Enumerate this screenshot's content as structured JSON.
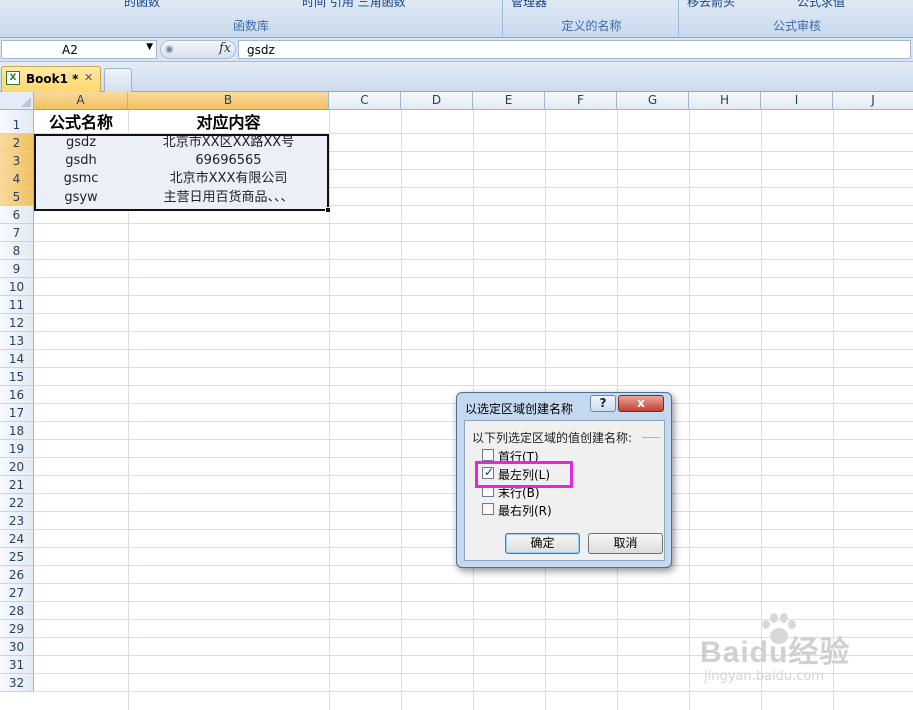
{
  "ribbon": {
    "group1_cut_text": "的函数",
    "group1_label": "函数库",
    "group1_extra_text": "时间   引用   三角函数",
    "group2_cut_text": "管理器",
    "group2_label": "定义的名称",
    "group3_cut_text": "移去箭头",
    "group3_cut_text2": "公式求值",
    "group3_label": "公式审核"
  },
  "formula_bar": {
    "name_box": "A2",
    "fx_symbol": "fx",
    "formula": "gsdz"
  },
  "tabs": {
    "active_label": "Book1 *",
    "close_symbol": "✕",
    "file_icon": "excel-file-icon"
  },
  "grid": {
    "columns": [
      "A",
      "B",
      "C",
      "D",
      "E",
      "F",
      "G",
      "H",
      "I",
      "J"
    ],
    "rows": [
      "1",
      "2",
      "3",
      "4",
      "5",
      "6",
      "7",
      "8",
      "9",
      "10",
      "11",
      "12",
      "13",
      "14",
      "15",
      "16",
      "17",
      "18",
      "19",
      "20",
      "21",
      "22",
      "23",
      "24",
      "25",
      "26",
      "27",
      "28",
      "29",
      "30",
      "31",
      "32"
    ],
    "cells": {
      "A1": "公式名称",
      "B1": "对应内容",
      "A2": "gsdz",
      "B2": "北京市XX区XX路XX号",
      "A3": "gsdh",
      "B3": "69696565",
      "A4": "gsmc",
      "B4": "北京市XXX有限公司",
      "A5": "gsyw",
      "B5": "主营日用百货商品、、、"
    }
  },
  "dialog": {
    "title": "以选定区域创建名称",
    "help_symbol": "?",
    "close_symbol": "x",
    "group_label": "以下列选定区域的值创建名称:",
    "options": [
      {
        "label": "首行(T)",
        "checked": false
      },
      {
        "label": "最左列(L)",
        "checked": true
      },
      {
        "label": "末行(B)",
        "checked": false
      },
      {
        "label": "最右列(R)",
        "checked": false
      }
    ],
    "checkmark": "✓",
    "ok_label": "确定",
    "cancel_label": "取消",
    "highlight_color": "#e326e3"
  },
  "watermark": {
    "brand": "Baidu经验",
    "url": "jingyan.baidu.com"
  }
}
